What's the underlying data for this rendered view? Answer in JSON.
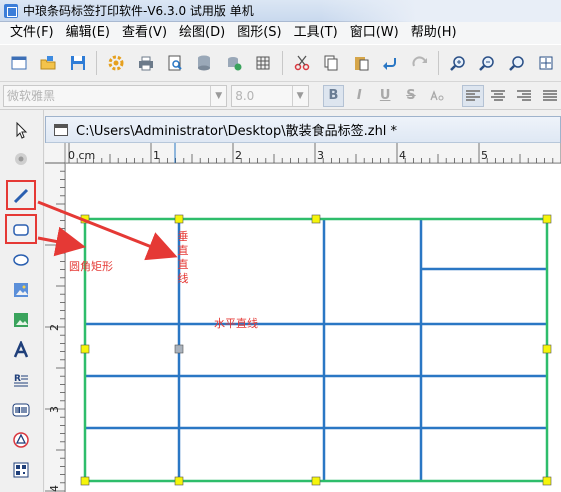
{
  "window": {
    "title": "中琅条码标签打印软件-V6.3.0 试用版 单机"
  },
  "menu": {
    "items": [
      {
        "label": "文件(F)"
      },
      {
        "label": "编辑(E)"
      },
      {
        "label": "查看(V)"
      },
      {
        "label": "绘图(D)"
      },
      {
        "label": "图形(S)"
      },
      {
        "label": "工具(T)"
      },
      {
        "label": "窗口(W)"
      },
      {
        "label": "帮助(H)"
      }
    ]
  },
  "format_toolbar": {
    "font_name": "微软雅黑",
    "font_size": "8.0",
    "bold": "B",
    "italic": "I",
    "underline": "U",
    "strike": "S"
  },
  "document": {
    "path": "C:\\Users\\Administrator\\Desktop\\散装食品标签.zhl *"
  },
  "ruler": {
    "unit": "0 cm",
    "h_ticks": [
      "1",
      "2",
      "3",
      "4",
      "5"
    ],
    "v_ticks": [
      "2",
      "3",
      "4"
    ]
  },
  "annotations": {
    "rounded_rect": "圆角矩形",
    "vertical_line": "垂直直线",
    "horizontal_line": "水平直线"
  },
  "colors": {
    "outer_border": "#2ebd6b",
    "grid_lines": "#2a77c4",
    "annotation": "#e53935",
    "handle": "#f5f50a"
  }
}
